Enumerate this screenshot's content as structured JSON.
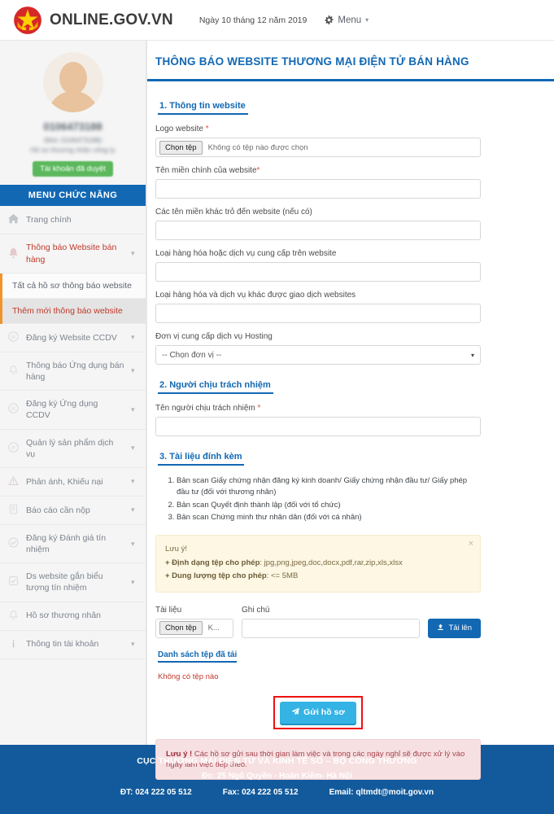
{
  "header": {
    "brand": "ONLINE.GOV.VN",
    "date": "Ngày 10 tháng 12 năm 2019",
    "menu_label": "Menu",
    "gear_icon": "gear-icon",
    "caret_icon": "chevron-down-icon",
    "emblem_icon": "vietnam-emblem-icon"
  },
  "sidebar": {
    "profile": {
      "account_id": "0106473188",
      "tax_line": "(Mst: 0106473188)",
      "org_line": "Hộ sơ thương nhân công ty",
      "badge": "Tài khoản đã duyệt"
    },
    "menu_title": "MENU CHỨC NĂNG",
    "items": [
      {
        "label": "Trang chính",
        "icon": "home-icon",
        "chevron": false,
        "active": false
      },
      {
        "label": "Thông báo Website bán hàng",
        "icon": "bell-icon",
        "chevron": true,
        "active": true
      },
      {
        "label": "Đăng ký Website CCDV",
        "icon": "registered-icon",
        "chevron": true,
        "active": false
      },
      {
        "label": "Thông báo Ứng dụng bán hàng",
        "icon": "bell-outline-icon",
        "chevron": true,
        "active": false
      },
      {
        "label": "Đăng ký Ứng dụng CCDV",
        "icon": "registered-icon",
        "chevron": true,
        "active": false
      },
      {
        "label": "Quản lý sản phẩm dịch vụ",
        "icon": "product-icon",
        "chevron": true,
        "active": false
      },
      {
        "label": "Phản ánh, Khiếu nại",
        "icon": "warning-icon",
        "chevron": true,
        "active": false
      },
      {
        "label": "Báo cáo cần nộp",
        "icon": "document-icon",
        "chevron": true,
        "active": false
      },
      {
        "label": "Đăng ký Đánh giá tín nhiệm",
        "icon": "check-circle-icon",
        "chevron": true,
        "active": false
      },
      {
        "label": "Ds website gắn biểu tượng tín nhiệm",
        "icon": "checkbox-icon",
        "chevron": true,
        "active": false
      },
      {
        "label": "Hồ sơ thương nhân",
        "icon": "bell-outline-icon",
        "chevron": false,
        "active": false
      },
      {
        "label": "Thông tin tài khoản",
        "icon": "info-icon",
        "chevron": true,
        "active": false
      }
    ],
    "submenu": [
      {
        "label": "Tất cả hồ sơ thông báo website",
        "selected": false
      },
      {
        "label": "Thêm mới thông báo website",
        "selected": true
      }
    ]
  },
  "main": {
    "page_title": "THÔNG BÁO WEBSITE THƯƠNG MẠI ĐIỆN TỬ BÁN HÀNG",
    "section1": {
      "heading": "1. Thông tin website",
      "logo_label": "Logo website",
      "logo_required": "*",
      "file_button": "Chọn tệp",
      "file_status": "Không có tệp nào được chọn",
      "fields": [
        {
          "label": "Tên miền chính của website",
          "required": "*",
          "value": ""
        },
        {
          "label": "Các tên miền khác trỏ đến website (nếu có)",
          "required": "",
          "value": ""
        },
        {
          "label": "Loại hàng hóa hoặc dịch vụ cung cấp trên website",
          "required": "",
          "value": ""
        },
        {
          "label": "Loại hàng hóa và dịch vụ khác được giao dịch websites",
          "required": "",
          "value": ""
        }
      ],
      "hosting_label": "Đơn vị cung cấp dịch vụ Hosting",
      "hosting_value": "-- Chọn đơn vị --"
    },
    "section2": {
      "heading": "2. Người chịu trách nhiệm",
      "name_label": "Tên người chịu trách nhiệm",
      "name_required": "*",
      "name_value": ""
    },
    "section3": {
      "heading": "3. Tài liệu đính kèm",
      "docs": [
        "Bản scan Giấy chứng nhận đăng ký kinh doanh/ Giấy chứng nhận đầu tư/ Giấy phép đầu tư (đối với thương nhân)",
        "Bản scan Quyết định thành lập (đối với tổ chức)",
        "Bản scan Chứng minh thư nhân dân (đối với cá nhân)"
      ],
      "note": {
        "title": "Lưu ý!",
        "line1_label": "+ Định dạng tệp cho phép",
        "line1_value": ": jpg,png,jpeg,doc,docx,pdf,rar,zip,xls,xlsx",
        "line2_label": "+ Dung lượng tệp cho phép",
        "line2_value": ": <= 5MB",
        "close_icon": "close-icon"
      },
      "upload": {
        "doc_label": "Tài liệu",
        "doc_button": "Chọn tệp",
        "doc_status": "K...",
        "note_label": "Ghi chú",
        "note_value": "",
        "upload_button": "Tải lên",
        "upload_icon": "upload-icon"
      },
      "file_list_heading": "Danh sách tệp đã tải",
      "file_list_empty": "Không có tệp nào"
    },
    "submit_button": "Gửi hồ sơ",
    "submit_icon": "paper-plane-icon",
    "pink_note_bold": "Lưu ý !",
    "pink_note_text": " Các hồ sơ gửi sau thời gian làm việc và trong các ngày nghỉ sẽ được xử lý vào ngày làm việc tiếp theo."
  },
  "footer": {
    "line1": "CỤC THƯƠNG MẠI ĐIỆN TỬ VÀ KINH TẾ SỐ – BỘ CÔNG THƯƠNG",
    "line2": "Đc: 25 Ngô Quyền - Hoàn Kiếm- Hà Nội",
    "phone": "ĐT: 024 222 05 512",
    "fax": "Fax: 024 222 05 512",
    "email": "Email: qltmdt@moit.gov.vn"
  },
  "colors": {
    "brand_blue": "#1268b3",
    "footer_blue": "#125a9c",
    "accent_orange": "#f0932b",
    "active_red": "#c0392b",
    "submit_blue": "#34b3e4",
    "annotation_red": "#ee1111",
    "approved_green": "#5cb85c"
  }
}
